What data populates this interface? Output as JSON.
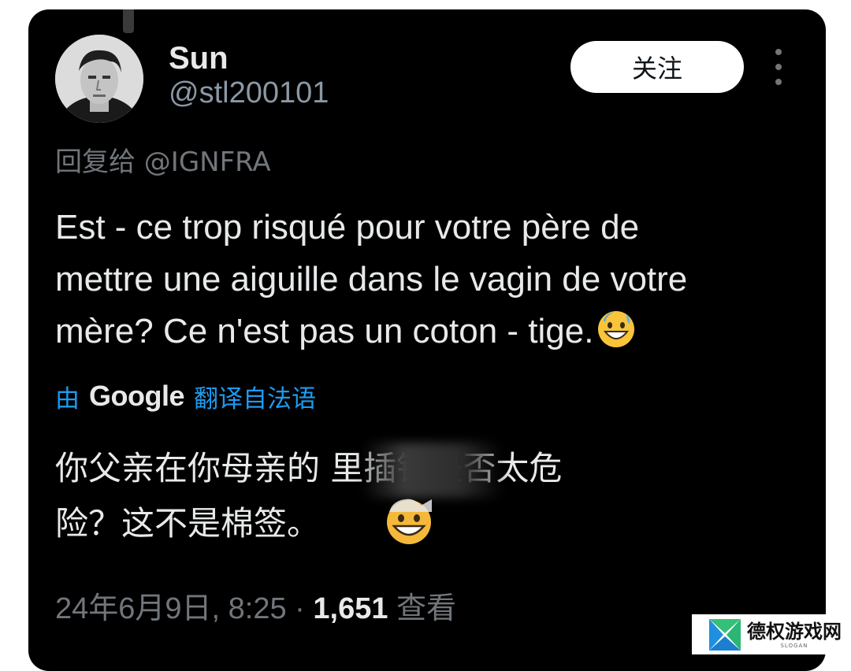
{
  "user": {
    "name": "Sun",
    "handle": "@stl200101"
  },
  "actions": {
    "follow_label": "关注"
  },
  "reply_to": "回复给 @IGNFRA",
  "tweet": {
    "text": "Est - ce trop risqué pour votre père de\nmettre une aiguille dans le vagin de votre\nmère? Ce n'est pas un coton - tige."
  },
  "translation": {
    "by": "由",
    "provider": "Google",
    "label": "翻译自法语",
    "text": "你父亲在你母亲的        里插针是否太危\n险？这不是棉签。"
  },
  "meta": {
    "datetime": "24年6月9日, 8:25 · ",
    "views_count": "1,651",
    "views_label": " 查看"
  },
  "watermark": {
    "text": "德权游戏网",
    "sub": "SLOGAN"
  },
  "icons": {
    "more": "more-vertical-icon",
    "emoji": "grinning-sweat-emoji"
  },
  "colors": {
    "background": "#000000",
    "primary_text": "#e7e9ea",
    "secondary_text": "#71767b",
    "link": "#1d9bf0",
    "button_bg": "#ffffff"
  }
}
